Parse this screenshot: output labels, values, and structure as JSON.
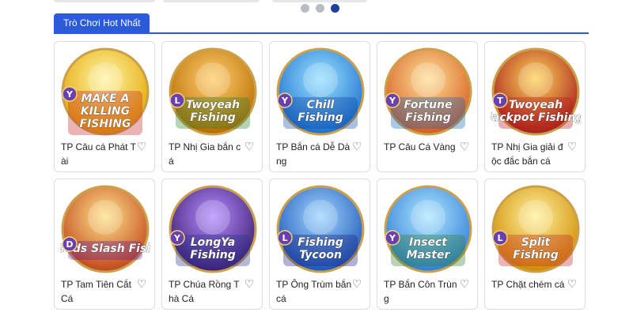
{
  "section": {
    "tab_label": "Trò Chơi Hot Nhất"
  },
  "carousel": {
    "dot_count": 3,
    "active_index": 2
  },
  "games": [
    {
      "title": "TP Câu cá Phát Tài",
      "badge": "Y",
      "art_text": [
        "MAKE A",
        "KILLING",
        "FISHING"
      ],
      "bg_top": "#fff6a8",
      "bg_bottom": "#e3a400",
      "ribbon": "#c62828"
    },
    {
      "title": "TP Nhị Gia bắn cá",
      "badge": "L",
      "art_text": [
        "Twoyeah",
        "Fishing"
      ],
      "bg_top": "#ffcf70",
      "bg_bottom": "#b86b00",
      "ribbon": "#2e7d32"
    },
    {
      "title": "TP Bắn cá Dễ Dàng",
      "badge": "Y",
      "art_text": [
        "Chill",
        "Fishing"
      ],
      "bg_top": "#9be2ff",
      "bg_bottom": "#1c6fd1",
      "ribbon": "#0d47a1"
    },
    {
      "title": "TP Câu Cá Vàng",
      "badge": "Y",
      "art_text": [
        "Fortune",
        "Fishing"
      ],
      "bg_top": "#ffe29a",
      "bg_bottom": "#d65b1e",
      "ribbon": "#1565c0"
    },
    {
      "title": "TP Nhị Gia giải độc đắc bắn cá",
      "badge": "T",
      "art_text": [
        "Twoyeah",
        "Jackpot Fishing"
      ],
      "bg_top": "#ffd45a",
      "bg_bottom": "#a61b1b",
      "ribbon": "#b71c1c"
    },
    {
      "title": "TP Tam Tiên Cắt Cá",
      "badge": "D",
      "art_text": [
        "Gods Slash Fish"
      ],
      "bg_top": "#ffe38a",
      "bg_bottom": "#c1461b",
      "ribbon": "#6a1b9a"
    },
    {
      "title": "TP Chúa Rồng Thà Cá",
      "badge": "Y",
      "art_text": [
        "LongYa",
        "Fishing"
      ],
      "bg_top": "#b58cff",
      "bg_bottom": "#3b1d6e",
      "ribbon": "#283593"
    },
    {
      "title": "TP Ông Trùm bắn cá",
      "badge": "L",
      "art_text": [
        "Fishing",
        "Tycoon"
      ],
      "bg_top": "#9fd6ff",
      "bg_bottom": "#1e56b8",
      "ribbon": "#1a237e"
    },
    {
      "title": "TP Bắn Côn Trùng",
      "badge": "Y",
      "art_text": [
        "Insect",
        "Master"
      ],
      "bg_top": "#b0e7ff",
      "bg_bottom": "#2e7dd6",
      "ribbon": "#2e7d32"
    },
    {
      "title": "TP Chặt chém cá",
      "badge": "L",
      "art_text": [
        "Split",
        "Fishing"
      ],
      "bg_top": "#fff1a0",
      "bg_bottom": "#d18b00",
      "ribbon": "#c62828"
    }
  ],
  "colors": {
    "accent": "#2b5bd7",
    "dot_active": "#1a3f9e",
    "dot_inactive": "#b9bcc3",
    "badge": "#6a3fb0"
  },
  "icons": {
    "favorite": "heart-outline-icon"
  }
}
